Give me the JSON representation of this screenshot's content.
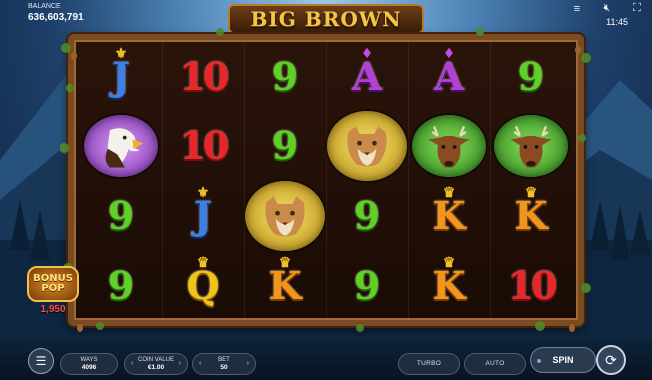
{
  "header": {
    "balance_label": "BALANCE",
    "balance_value": "636,603,791",
    "time": "11:45",
    "icons": [
      "menu-lines-icon",
      "speaker-muted-icon",
      "fullscreen-icon"
    ]
  },
  "logo": {
    "text": "BIG BROWN"
  },
  "reels": {
    "columns": [
      [
        {
          "type": "J",
          "ornament": "fleur"
        },
        {
          "type": "eagle",
          "bg": "purple"
        },
        {
          "type": "9"
        },
        {
          "type": "9"
        }
      ],
      [
        {
          "type": "10"
        },
        {
          "type": "10"
        },
        {
          "type": "J",
          "ornament": "fleur"
        },
        {
          "type": "Q",
          "ornament": "crown"
        }
      ],
      [
        {
          "type": "9"
        },
        {
          "type": "9"
        },
        {
          "type": "cougar",
          "bg": "gold"
        },
        {
          "type": "K",
          "ornament": "crown"
        }
      ],
      [
        {
          "type": "A",
          "ornament": "diamond"
        },
        {
          "type": "cougar",
          "bg": "gold"
        },
        {
          "type": "9"
        },
        {
          "type": "9"
        }
      ],
      [
        {
          "type": "A",
          "ornament": "diamond"
        },
        {
          "type": "stag",
          "bg": "green"
        },
        {
          "type": "K",
          "ornament": "crown"
        },
        {
          "type": "K",
          "ornament": "crown"
        }
      ],
      [
        {
          "type": "9"
        },
        {
          "type": "stag",
          "bg": "green"
        },
        {
          "type": "K",
          "ornament": "crown"
        },
        {
          "type": "10"
        }
      ]
    ]
  },
  "bonus": {
    "line1": "BONUS",
    "line2": "POP",
    "value": "1,950"
  },
  "footer": {
    "ways_label": "WAYS",
    "ways_value": "4096",
    "coin_label": "COIN VALUE",
    "coin_value": "€1.00",
    "bet_label": "BET",
    "bet_value": "50",
    "turbo_label": "TURBO",
    "auto_label": "AUTO",
    "spin_label": "SPIN"
  }
}
